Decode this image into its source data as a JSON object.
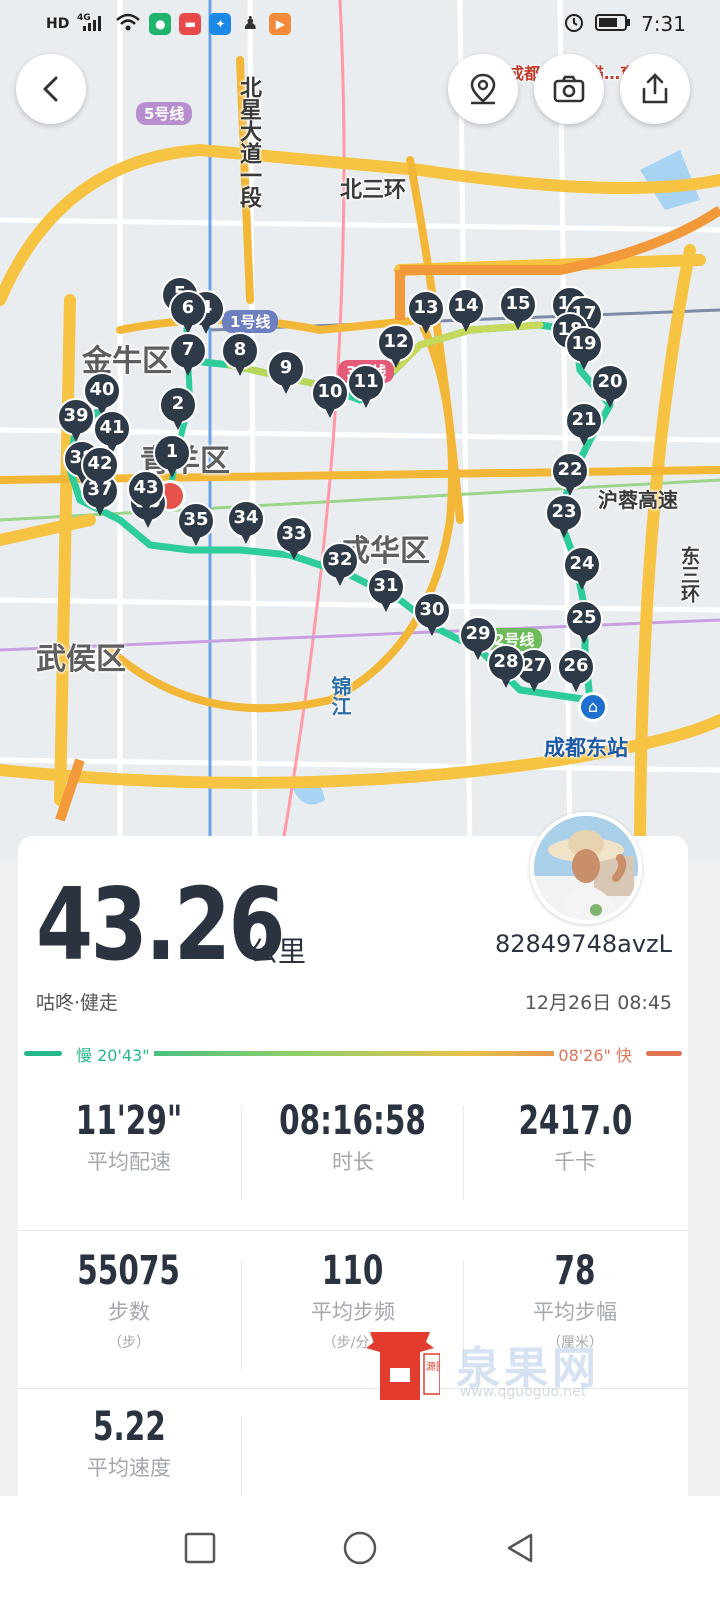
{
  "status_bar": {
    "left_icons": [
      "hd-icon",
      "4g-signal-icon",
      "wifi-icon",
      "app-notification-icons"
    ],
    "hd": "HD",
    "network": "4G",
    "time": "7:31"
  },
  "map": {
    "districts": [
      "金牛区",
      "青羊区",
      "成华区",
      "武侯区"
    ],
    "roads": [
      "北星大道一段",
      "北三环",
      "沪蓉高速",
      "东三环"
    ],
    "metro_lines": [
      "5号线",
      "1号线",
      "3号线",
      "2号线"
    ],
    "river": "锦江",
    "station": "成都东站",
    "poi_partial": "成都…大熊猫…育基地",
    "route_color": "#2ecc9a",
    "markers": [
      "1",
      "2",
      "3",
      "4",
      "5",
      "6",
      "7",
      "8",
      "9",
      "10",
      "11",
      "12",
      "13",
      "14",
      "15",
      "16",
      "17",
      "18",
      "19",
      "20",
      "21",
      "22",
      "23",
      "24",
      "25",
      "26",
      "27",
      "28",
      "29",
      "30",
      "31",
      "32",
      "33",
      "34",
      "35",
      "36",
      "37",
      "38",
      "39",
      "40",
      "41",
      "42",
      "43"
    ]
  },
  "actions": {
    "back": "back-icon",
    "location": "location-icon",
    "camera": "camera-icon",
    "share": "share-icon"
  },
  "summary": {
    "distance": "43.26",
    "distance_unit": "公里",
    "username": "82849748avzL",
    "activity_type": "咕咚·健走",
    "date": "12月26日 08:45",
    "pace_slow": "慢 20'43\"",
    "pace_fast": "08'26\" 快",
    "pace_colors": [
      "#25b88c",
      "#8fcf6a",
      "#e8c24a",
      "#e07556"
    ]
  },
  "stats": [
    {
      "value": "11'29\"",
      "label": "平均配速",
      "unit": ""
    },
    {
      "value": "08:16:58",
      "label": "时长",
      "unit": ""
    },
    {
      "value": "2417.0",
      "label": "千卡",
      "unit": ""
    },
    {
      "value": "55075",
      "label": "步数",
      "unit": "（步）"
    },
    {
      "value": "110",
      "label": "平均步频",
      "unit": "（步/分）"
    },
    {
      "value": "78",
      "label": "平均步幅",
      "unit": "（厘米）"
    },
    {
      "value": "5.22",
      "label": "平均速度",
      "unit": ""
    }
  ],
  "watermark": {
    "text": "泉果网",
    "url": "www.qguoguo.net",
    "seal": "源图"
  },
  "nav": {
    "recents": "recents-square-icon",
    "home": "home-circle-icon",
    "back": "back-triangle-icon"
  }
}
